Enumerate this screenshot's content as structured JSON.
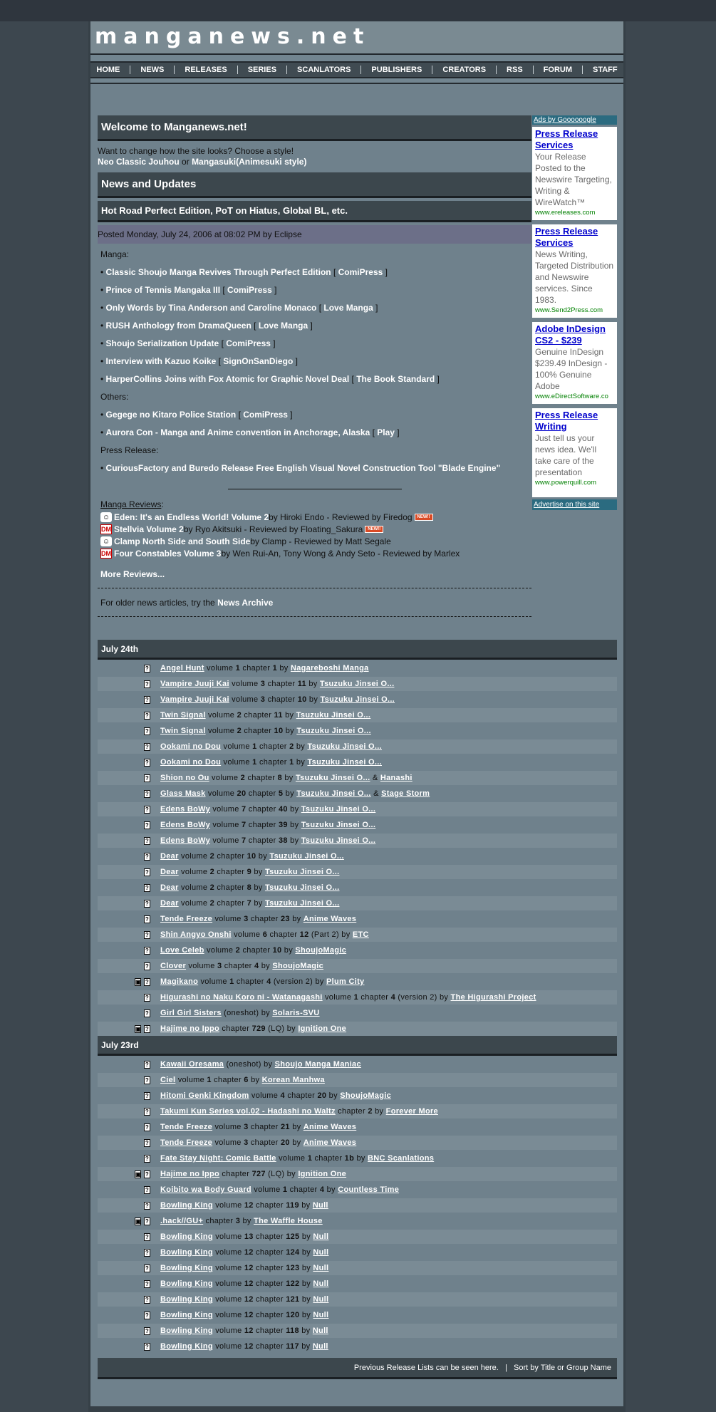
{
  "site": {
    "logo": "manganews.net"
  },
  "nav": [
    "HOME",
    "NEWS",
    "RELEASES",
    "SERIES",
    "SCANLATORS",
    "PUBLISHERS",
    "CREATORS",
    "RSS",
    "FORUM",
    "STAFF"
  ],
  "welcome": {
    "title": "Welcome to Manganews.net!",
    "prompt": "Want to change how the site looks? Choose a style!",
    "style1": "Neo",
    "style2": "Classic Jouhou",
    "or": "or",
    "style3": "Mangasuki(Animesuki style)"
  },
  "news": {
    "section": "News and Updates",
    "headline": "Hot Road Perfect Edition, PoT on Hiatus, Global BL, etc.",
    "posted": "Posted Monday, July 24, 2006 at 08:02 PM by Eclipse",
    "manga_label": "Manga:",
    "manga": [
      {
        "title": "Classic Shoujo Manga Revives Through Perfect Edition",
        "src": "ComiPress"
      },
      {
        "title": "Prince of Tennis Mangaka III",
        "src": "ComiPress"
      },
      {
        "title": "Only Words by Tina Anderson and Caroline Monaco",
        "src": "Love Manga"
      },
      {
        "title": "RUSH Anthology from DramaQueen",
        "src": "Love Manga"
      },
      {
        "title": "Shoujo Serialization Update",
        "src": "ComiPress"
      },
      {
        "title": "Interview with Kazuo Koike",
        "src": "SignOnSanDiego"
      },
      {
        "title": "HarperCollins Joins with Fox Atomic for Graphic Novel Deal",
        "src": "The Book Standard"
      }
    ],
    "others_label": "Others:",
    "others": [
      {
        "title": "Gegege no Kitaro Police Station",
        "src": "ComiPress"
      },
      {
        "title": "Aurora Con - Manga and Anime convention in Anchorage, Alaska",
        "src": "Play"
      }
    ],
    "press_label": "Press Release:",
    "press": [
      {
        "title": "CuriousFactory and Buredo Release Free English Visual Novel Construction Tool \"Blade Engine\""
      }
    ],
    "reviews_label": "Manga Reviews",
    "reviews": [
      {
        "icon": "pic",
        "title": "Eden: It's an Endless World! Volume 2",
        "rest": "by Hiroki Endo - Reviewed by Firedog",
        "new": "NEW!!"
      },
      {
        "icon": "dm",
        "title": "Stellvia Volume 2",
        "rest": "by Ryo Akitsuki - Reviewed by Floating_Sakura",
        "new": "NEW!!"
      },
      {
        "icon": "pic",
        "title": "Clamp North Side and South Side",
        "rest": "by Clamp - Reviewed by Matt Segale",
        "new": ""
      },
      {
        "icon": "dm",
        "title": "Four Constables Volume 3",
        "rest": "by Wen Rui-An, Tony Wong & Andy Seto - Reviewed by Marlex",
        "new": ""
      }
    ],
    "more_reviews": "More Reviews...",
    "archive_prefix": "For older news articles, try the",
    "archive_link": "News Archive"
  },
  "ads": {
    "top": "Ads by Goooooogle",
    "bottom": "Advertise on this site",
    "units": [
      {
        "title": "Press Release Services",
        "desc": "Your Release Posted to the Newswire Targeting, Writing & WireWatch™",
        "url": "www.ereleases.com"
      },
      {
        "title": "Press Release Services",
        "desc": "News Writing, Targeted Distribution and Newswire services. Since 1983.",
        "url": "www.Send2Press.com"
      },
      {
        "title": "Adobe InDesign CS2 - $239",
        "desc": "Genuine InDesign $239.49 InDesign - 100% Genuine Adobe",
        "url": "www.eDirectSoftware.co"
      },
      {
        "title": "Press Release Writing",
        "desc": "Just tell us your news idea. We'll take care of the presentation",
        "url": "www.powerquill.com"
      }
    ]
  },
  "releases": {
    "days": [
      {
        "date": "July 24th",
        "items": [
          {
            "pic": false,
            "series": "Angel Hunt",
            "info": [
              " volume ",
              "1",
              " chapter ",
              "1",
              " by "
            ],
            "groups": [
              "Nagareboshi Manga"
            ]
          },
          {
            "pic": false,
            "series": "Vampire Juuji Kai",
            "info": [
              " volume ",
              "3",
              " chapter ",
              "11",
              " by "
            ],
            "groups": [
              "Tsuzuku Jinsei O..."
            ]
          },
          {
            "pic": false,
            "series": "Vampire Juuji Kai",
            "info": [
              " volume ",
              "3",
              " chapter ",
              "10",
              " by "
            ],
            "groups": [
              "Tsuzuku Jinsei O..."
            ]
          },
          {
            "pic": false,
            "series": "Twin Signal",
            "info": [
              " volume ",
              "2",
              " chapter ",
              "11",
              " by "
            ],
            "groups": [
              "Tsuzuku Jinsei O..."
            ]
          },
          {
            "pic": false,
            "series": "Twin Signal",
            "info": [
              " volume ",
              "2",
              " chapter ",
              "10",
              " by "
            ],
            "groups": [
              "Tsuzuku Jinsei O..."
            ]
          },
          {
            "pic": false,
            "series": "Ookami no Dou",
            "info": [
              " volume ",
              "1",
              " chapter ",
              "2",
              " by "
            ],
            "groups": [
              "Tsuzuku Jinsei O..."
            ]
          },
          {
            "pic": false,
            "series": "Ookami no Dou",
            "info": [
              " volume ",
              "1",
              " chapter ",
              "1",
              " by "
            ],
            "groups": [
              "Tsuzuku Jinsei O..."
            ]
          },
          {
            "pic": false,
            "series": "Shion no Ou",
            "info": [
              " volume ",
              "2",
              " chapter ",
              "8",
              " by "
            ],
            "groups": [
              "Tsuzuku Jinsei O...",
              "Hanashi"
            ]
          },
          {
            "pic": false,
            "series": "Glass Mask",
            "info": [
              " volume ",
              "20",
              " chapter ",
              "5",
              " by "
            ],
            "groups": [
              "Tsuzuku Jinsei O...",
              "Stage Storm"
            ]
          },
          {
            "pic": false,
            "series": "Edens BoWy",
            "info": [
              " volume ",
              "7",
              " chapter ",
              "40",
              " by "
            ],
            "groups": [
              "Tsuzuku Jinsei O..."
            ]
          },
          {
            "pic": false,
            "series": "Edens BoWy",
            "info": [
              " volume ",
              "7",
              " chapter ",
              "39",
              " by "
            ],
            "groups": [
              "Tsuzuku Jinsei O..."
            ]
          },
          {
            "pic": false,
            "series": "Edens BoWy",
            "info": [
              " volume ",
              "7",
              " chapter ",
              "38",
              " by "
            ],
            "groups": [
              "Tsuzuku Jinsei O..."
            ]
          },
          {
            "pic": false,
            "series": "Dear",
            "info": [
              " volume ",
              "2",
              " chapter ",
              "10",
              " by "
            ],
            "groups": [
              "Tsuzuku Jinsei O..."
            ]
          },
          {
            "pic": false,
            "series": "Dear",
            "info": [
              " volume ",
              "2",
              " chapter ",
              "9",
              " by "
            ],
            "groups": [
              "Tsuzuku Jinsei O..."
            ]
          },
          {
            "pic": false,
            "series": "Dear",
            "info": [
              " volume ",
              "2",
              " chapter ",
              "8",
              " by "
            ],
            "groups": [
              "Tsuzuku Jinsei O..."
            ]
          },
          {
            "pic": false,
            "series": "Dear",
            "info": [
              " volume ",
              "2",
              " chapter ",
              "7",
              " by "
            ],
            "groups": [
              "Tsuzuku Jinsei O..."
            ]
          },
          {
            "pic": false,
            "series": "Tende Freeze",
            "info": [
              " volume ",
              "3",
              " chapter ",
              "23",
              " by "
            ],
            "groups": [
              "Anime Waves"
            ]
          },
          {
            "pic": false,
            "series": "Shin Angyo Onshi",
            "info": [
              " volume ",
              "6",
              " chapter ",
              "12",
              " (Part 2) by "
            ],
            "groups": [
              "ETC"
            ]
          },
          {
            "pic": false,
            "series": "Love Celeb",
            "info": [
              " volume ",
              "2",
              " chapter ",
              "10",
              " by "
            ],
            "groups": [
              "ShoujoMagic"
            ]
          },
          {
            "pic": false,
            "series": "Clover",
            "info": [
              " volume ",
              "3",
              " chapter ",
              "4",
              " by "
            ],
            "groups": [
              "ShoujoMagic"
            ]
          },
          {
            "pic": true,
            "series": "Magikano",
            "info": [
              " volume ",
              "1",
              " chapter ",
              "4",
              " (version 2) by "
            ],
            "groups": [
              "Plum City"
            ]
          },
          {
            "pic": false,
            "series": "Higurashi no Naku Koro ni - Watanagashi",
            "info": [
              " volume ",
              "1",
              " chapter ",
              "4",
              " (version 2) by "
            ],
            "groups": [
              "The Higurashi Project"
            ]
          },
          {
            "pic": false,
            "series": "Girl Girl Sisters",
            "info": [
              " (oneshot) by "
            ],
            "groups": [
              "Solaris-SVU"
            ]
          },
          {
            "pic": true,
            "series": "Hajime no Ippo",
            "info": [
              " chapter ",
              "729",
              " (LQ) by "
            ],
            "groups": [
              "Ignition One"
            ]
          }
        ]
      },
      {
        "date": "July 23rd",
        "items": [
          {
            "pic": false,
            "series": "Kawaii Oresama",
            "info": [
              " (oneshot) by "
            ],
            "groups": [
              "Shoujo Manga Maniac"
            ]
          },
          {
            "pic": false,
            "series": "Ciel",
            "info": [
              " volume ",
              "1",
              " chapter ",
              "6",
              " by "
            ],
            "groups": [
              "Korean Manhwa"
            ]
          },
          {
            "pic": false,
            "series": "Hitomi Genki Kingdom",
            "info": [
              " volume ",
              "4",
              " chapter ",
              "20",
              " by "
            ],
            "groups": [
              "ShoujoMagic"
            ]
          },
          {
            "pic": false,
            "series": "Takumi Kun Series vol.02 - Hadashi no Waltz",
            "info": [
              " chapter ",
              "2",
              " by "
            ],
            "groups": [
              "Forever More"
            ]
          },
          {
            "pic": false,
            "series": "Tende Freeze",
            "info": [
              " volume ",
              "3",
              " chapter ",
              "21",
              " by "
            ],
            "groups": [
              "Anime Waves"
            ]
          },
          {
            "pic": false,
            "series": "Tende Freeze",
            "info": [
              " volume ",
              "3",
              " chapter ",
              "20",
              " by "
            ],
            "groups": [
              "Anime Waves"
            ]
          },
          {
            "pic": false,
            "series": "Fate Stay Night: Comic Battle",
            "info": [
              " volume ",
              "1",
              " chapter ",
              "1b",
              " by "
            ],
            "groups": [
              "BNC Scanlations"
            ]
          },
          {
            "pic": true,
            "series": "Hajime no Ippo",
            "info": [
              " chapter ",
              "727",
              " (LQ) by "
            ],
            "groups": [
              "Ignition One"
            ]
          },
          {
            "pic": false,
            "series": "Koibito wa Body Guard",
            "info": [
              " volume ",
              "1",
              " chapter ",
              "4",
              " by "
            ],
            "groups": [
              "Countless Time"
            ]
          },
          {
            "pic": false,
            "series": "Bowling King",
            "info": [
              " volume ",
              "12",
              " chapter ",
              "119",
              " by "
            ],
            "groups": [
              "Null"
            ]
          },
          {
            "pic": true,
            "series": ".hack//GU+",
            "info": [
              " chapter ",
              "3",
              " by "
            ],
            "groups": [
              "The Waffle House"
            ]
          },
          {
            "pic": false,
            "series": "Bowling King",
            "info": [
              " volume ",
              "13",
              " chapter ",
              "125",
              " by "
            ],
            "groups": [
              "Null"
            ]
          },
          {
            "pic": false,
            "series": "Bowling King",
            "info": [
              " volume ",
              "12",
              " chapter ",
              "124",
              " by "
            ],
            "groups": [
              "Null"
            ]
          },
          {
            "pic": false,
            "series": "Bowling King",
            "info": [
              " volume ",
              "12",
              " chapter ",
              "123",
              " by "
            ],
            "groups": [
              "Null"
            ]
          },
          {
            "pic": false,
            "series": "Bowling King",
            "info": [
              " volume ",
              "12",
              " chapter ",
              "122",
              " by "
            ],
            "groups": [
              "Null"
            ]
          },
          {
            "pic": false,
            "series": "Bowling King",
            "info": [
              " volume ",
              "12",
              " chapter ",
              "121",
              " by "
            ],
            "groups": [
              "Null"
            ]
          },
          {
            "pic": false,
            "series": "Bowling King",
            "info": [
              " volume ",
              "12",
              " chapter ",
              "120",
              " by "
            ],
            "groups": [
              "Null"
            ]
          },
          {
            "pic": false,
            "series": "Bowling King",
            "info": [
              " volume ",
              "12",
              " chapter ",
              "118",
              " by "
            ],
            "groups": [
              "Null"
            ]
          },
          {
            "pic": false,
            "series": "Bowling King",
            "info": [
              " volume ",
              "12",
              " chapter ",
              "117",
              " by "
            ],
            "groups": [
              "Null"
            ]
          }
        ]
      }
    ],
    "footer_prev": "Previous Release Lists can be seen here.",
    "footer_sep": "|",
    "footer_sort": "Sort by Title or Group Name"
  }
}
